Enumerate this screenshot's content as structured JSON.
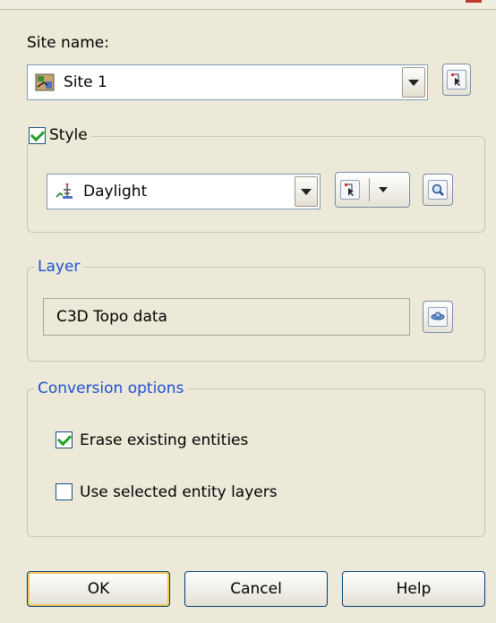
{
  "site": {
    "label": "Site name:",
    "value": "Site 1",
    "icon": "site-icon"
  },
  "style": {
    "checkbox_label": "Style",
    "checked": true,
    "value": "Daylight",
    "icon": "daylight-style-icon"
  },
  "layer": {
    "legend": "Layer",
    "value": "C3D Topo data"
  },
  "conversion": {
    "legend": "Conversion options",
    "erase_label": "Erase existing entities",
    "erase_checked": true,
    "use_layers_label": "Use selected entity layers",
    "use_layers_checked": false
  },
  "buttons": {
    "ok": "OK",
    "cancel": "Cancel",
    "help": "Help"
  },
  "colors": {
    "background": "#ECE9D8",
    "legend_blue": "#1F4FD1",
    "check_green": "#21A121"
  }
}
